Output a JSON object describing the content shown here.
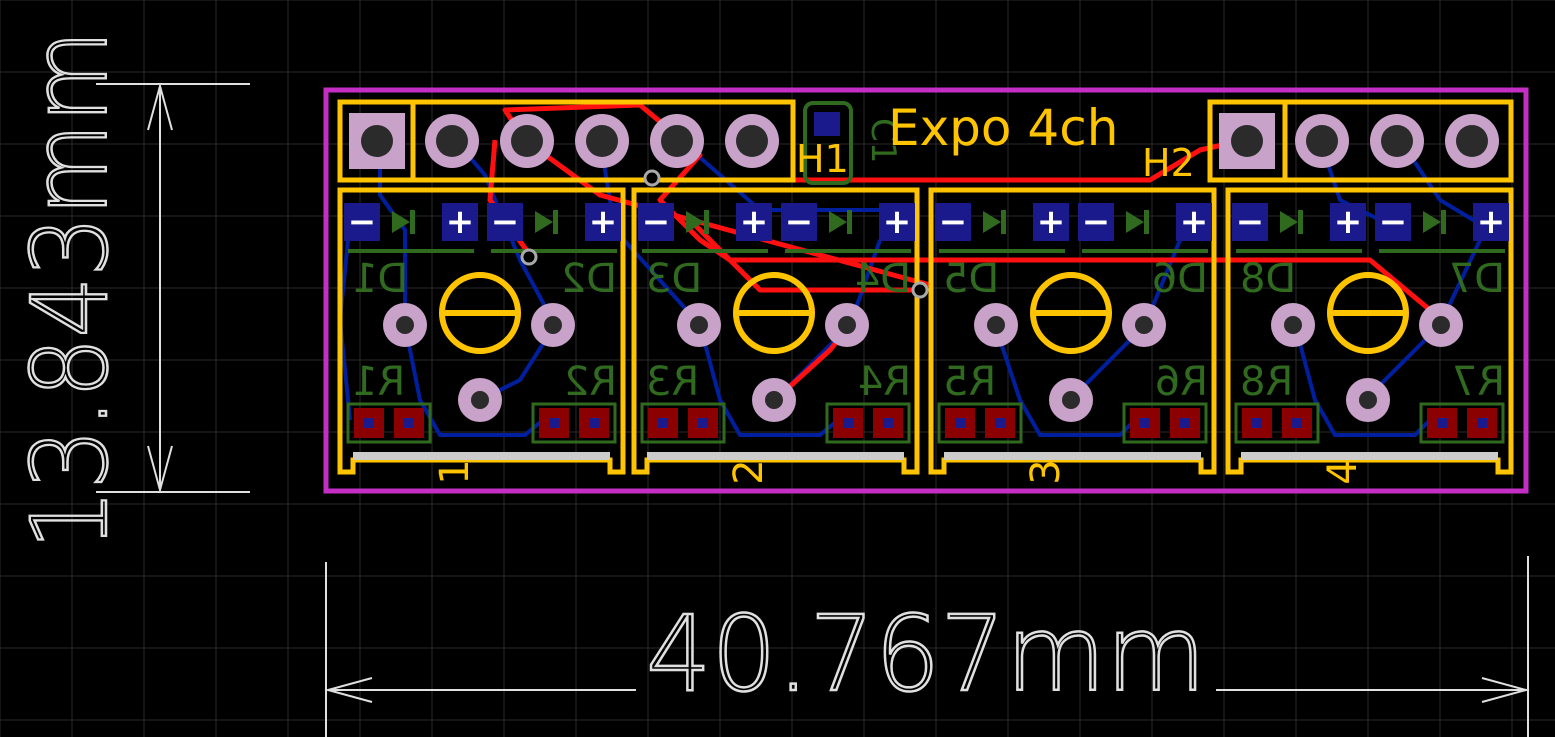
{
  "colors": {
    "background": "#000000",
    "grid": "#2a2a2a",
    "outline": "#c52ec5",
    "silk_top": "#ffc400",
    "bottom_silk": "#2f6a1f",
    "pad_copper": "#1a1a8c",
    "pad_ring": "#c8a2c8",
    "pth": "#a9a9a9",
    "bottom_copper": "#001f9e",
    "top_copper": "#ff1010",
    "smd_pad": "#8b0000",
    "dimension": "#e0e0e0"
  },
  "dimensions": {
    "height": "13.843mm",
    "width": "40.767mm"
  },
  "board": {
    "title": "Expo 4ch",
    "headers": [
      {
        "name": "H1",
        "pins": 6
      },
      {
        "name": "H2",
        "pins": 4
      }
    ],
    "capacitor": "C1",
    "channels": [
      {
        "number": "1",
        "diodes": [
          "D1",
          "D2"
        ],
        "resistors": [
          "R1",
          "R2"
        ]
      },
      {
        "number": "2",
        "diodes": [
          "D3",
          "D4"
        ],
        "resistors": [
          "R3",
          "R4"
        ]
      },
      {
        "number": "3",
        "diodes": [
          "D5",
          "D6"
        ],
        "resistors": [
          "R5",
          "R6"
        ]
      },
      {
        "number": "4",
        "diodes": [
          "D8",
          "D7"
        ],
        "resistors": [
          "R8",
          "R7"
        ]
      }
    ],
    "pad_symbols": {
      "minus": "−",
      "plus": "+"
    }
  },
  "icons": {
    "diode": "diode-icon",
    "trimmer": "trimmer-potentiometer-icon"
  }
}
